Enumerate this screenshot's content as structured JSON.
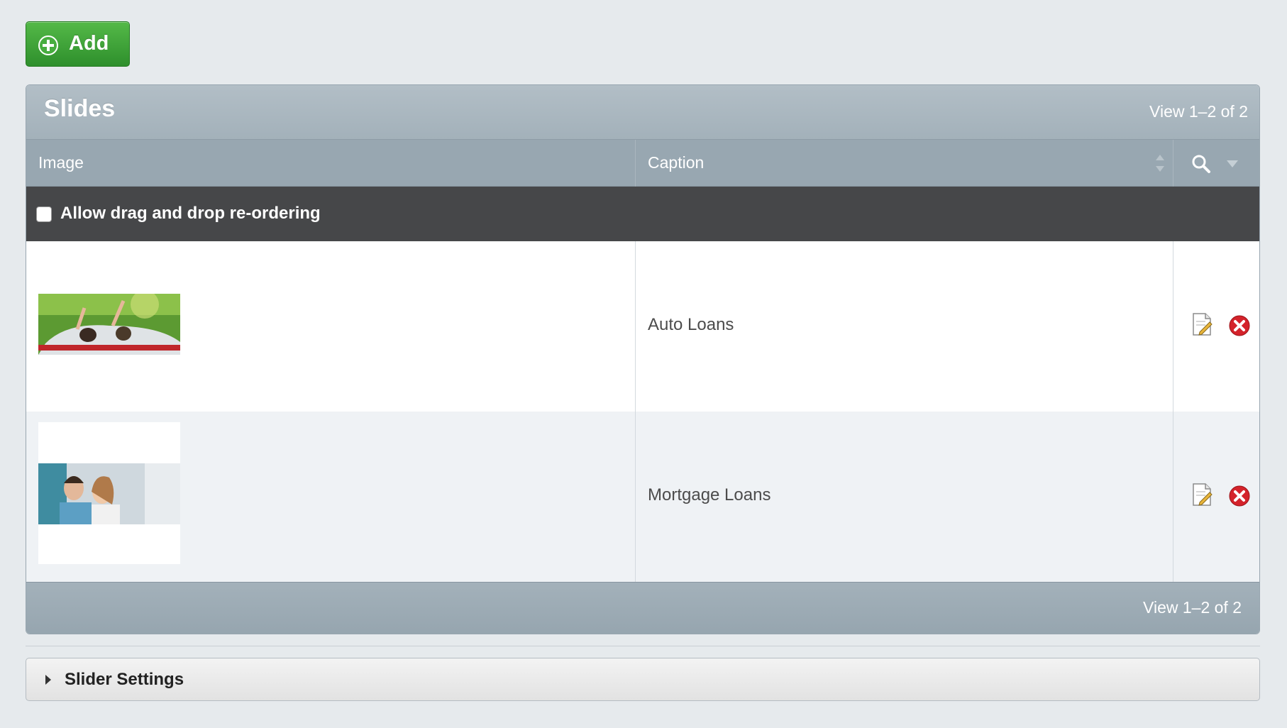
{
  "toolbar": {
    "add_label": "Add"
  },
  "grid": {
    "title": "Slides",
    "view_count": "View 1–2 of 2",
    "columns": {
      "image": "Image",
      "caption": "Caption"
    },
    "drag_drop_label": "Allow drag and drop re-ordering",
    "rows": [
      {
        "caption": "Auto Loans"
      },
      {
        "caption": "Mortgage Loans"
      }
    ],
    "footer_view_count": "View 1–2 of 2"
  },
  "settings_panel": {
    "label": "Slider Settings",
    "expanded": false
  },
  "colors": {
    "add_green": "#3fa33a",
    "header_blue_gray": "#98a7b1",
    "drag_bar": "#464749",
    "delete_red": "#d4232b"
  }
}
